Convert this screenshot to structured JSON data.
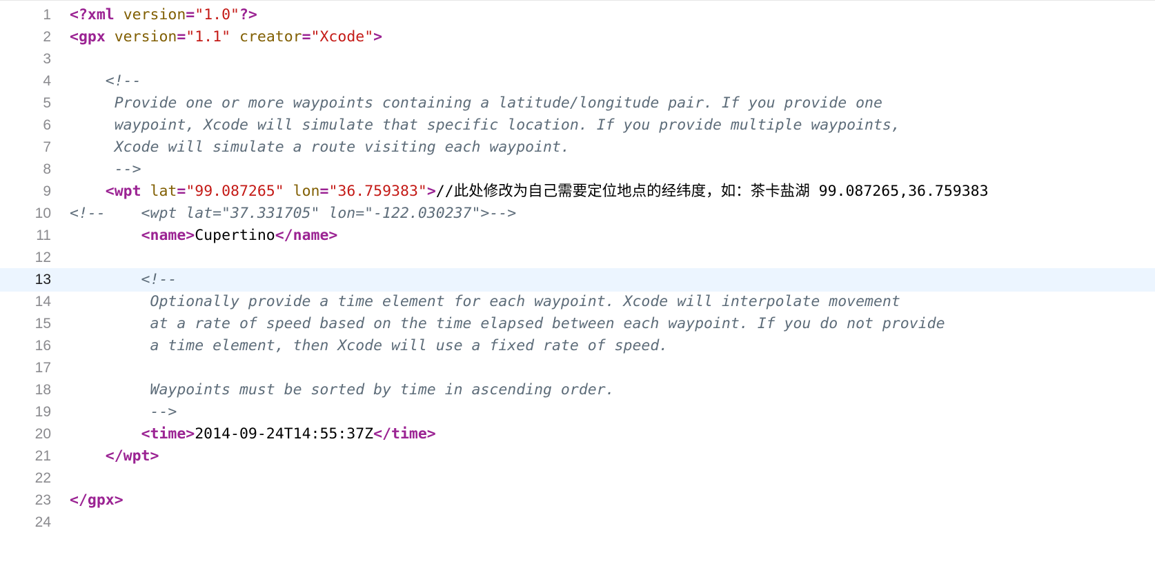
{
  "editor": {
    "current_line": "13",
    "lines": [
      {
        "num": "1",
        "segments": [
          {
            "t": "tag",
            "v": "<?xml"
          },
          {
            "t": "plain",
            "v": " "
          },
          {
            "t": "attr",
            "v": "version"
          },
          {
            "t": "tag",
            "v": "="
          },
          {
            "t": "str",
            "v": "\"1.0\""
          },
          {
            "t": "tag",
            "v": "?>"
          }
        ]
      },
      {
        "num": "2",
        "segments": [
          {
            "t": "tag",
            "v": "<gpx"
          },
          {
            "t": "plain",
            "v": " "
          },
          {
            "t": "attr",
            "v": "version"
          },
          {
            "t": "tag",
            "v": "="
          },
          {
            "t": "str",
            "v": "\"1.1\""
          },
          {
            "t": "plain",
            "v": " "
          },
          {
            "t": "attr",
            "v": "creator"
          },
          {
            "t": "tag",
            "v": "="
          },
          {
            "t": "str",
            "v": "\"Xcode\""
          },
          {
            "t": "tag",
            "v": ">"
          }
        ]
      },
      {
        "num": "3",
        "segments": []
      },
      {
        "num": "4",
        "segments": [
          {
            "t": "cmt",
            "v": "    <!--"
          }
        ]
      },
      {
        "num": "5",
        "segments": [
          {
            "t": "cmt",
            "v": "     Provide one or more waypoints containing a latitude/longitude pair. If you provide one"
          }
        ]
      },
      {
        "num": "6",
        "segments": [
          {
            "t": "cmt",
            "v": "     waypoint, Xcode will simulate that specific location. If you provide multiple waypoints,"
          }
        ]
      },
      {
        "num": "7",
        "segments": [
          {
            "t": "cmt",
            "v": "     Xcode will simulate a route visiting each waypoint."
          }
        ]
      },
      {
        "num": "8",
        "segments": [
          {
            "t": "cmt",
            "v": "     -->"
          }
        ]
      },
      {
        "num": "9",
        "segments": [
          {
            "t": "plain",
            "v": "    "
          },
          {
            "t": "tag",
            "v": "<wpt"
          },
          {
            "t": "plain",
            "v": " "
          },
          {
            "t": "attr",
            "v": "lat"
          },
          {
            "t": "tag",
            "v": "="
          },
          {
            "t": "str",
            "v": "\"99.087265\""
          },
          {
            "t": "plain",
            "v": " "
          },
          {
            "t": "attr",
            "v": "lon"
          },
          {
            "t": "tag",
            "v": "="
          },
          {
            "t": "str",
            "v": "\"36.759383\""
          },
          {
            "t": "tag",
            "v": ">"
          },
          {
            "t": "plain",
            "v": "//此处修改为自己需要定位地点的经纬度，如：茶卡盐湖 99.087265,36.759383"
          }
        ]
      },
      {
        "num": "10",
        "segments": [
          {
            "t": "cmt",
            "v": "<!--    <wpt lat=\"37.331705\" lon=\"-122.030237\">-->"
          }
        ]
      },
      {
        "num": "11",
        "segments": [
          {
            "t": "plain",
            "v": "        "
          },
          {
            "t": "tag",
            "v": "<name>"
          },
          {
            "t": "plain",
            "v": "Cupertino"
          },
          {
            "t": "tag",
            "v": "</name>"
          }
        ]
      },
      {
        "num": "12",
        "segments": []
      },
      {
        "num": "13",
        "segments": [
          {
            "t": "cmt",
            "v": "        <!--"
          }
        ]
      },
      {
        "num": "14",
        "segments": [
          {
            "t": "cmt",
            "v": "         Optionally provide a time element for each waypoint. Xcode will interpolate movement"
          }
        ]
      },
      {
        "num": "15",
        "segments": [
          {
            "t": "cmt",
            "v": "         at a rate of speed based on the time elapsed between each waypoint. If you do not provide"
          }
        ]
      },
      {
        "num": "16",
        "segments": [
          {
            "t": "cmt",
            "v": "         a time element, then Xcode will use a fixed rate of speed."
          }
        ]
      },
      {
        "num": "17",
        "segments": []
      },
      {
        "num": "18",
        "segments": [
          {
            "t": "cmt",
            "v": "         Waypoints must be sorted by time in ascending order."
          }
        ]
      },
      {
        "num": "19",
        "segments": [
          {
            "t": "cmt",
            "v": "         -->"
          }
        ]
      },
      {
        "num": "20",
        "segments": [
          {
            "t": "plain",
            "v": "        "
          },
          {
            "t": "tag",
            "v": "<time>"
          },
          {
            "t": "plain",
            "v": "2014-09-24T14:55:37Z"
          },
          {
            "t": "tag",
            "v": "</time>"
          }
        ]
      },
      {
        "num": "21",
        "segments": [
          {
            "t": "plain",
            "v": "    "
          },
          {
            "t": "tag",
            "v": "</wpt>"
          }
        ]
      },
      {
        "num": "22",
        "segments": []
      },
      {
        "num": "23",
        "segments": [
          {
            "t": "tag",
            "v": "</gpx>"
          }
        ]
      },
      {
        "num": "24",
        "segments": []
      }
    ]
  }
}
